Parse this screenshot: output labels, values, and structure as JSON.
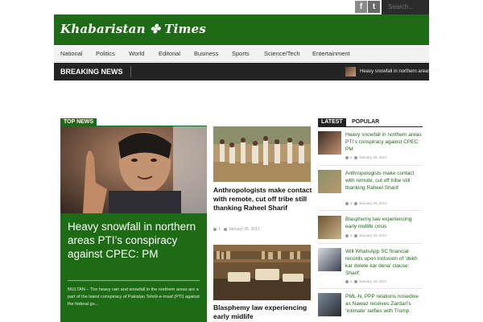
{
  "topbar": {
    "social": [
      {
        "name": "facebook-icon",
        "glyph": "f"
      },
      {
        "name": "twitter-icon",
        "glyph": "t"
      }
    ],
    "search_placeholder": "Search..."
  },
  "masthead": {
    "logo_text": "Khabaristan ✤ Times"
  },
  "nav": {
    "items": [
      "National",
      "Politics",
      "World",
      "Editorial",
      "Business",
      "Sports",
      "Science/Tech",
      "Entertainment"
    ]
  },
  "breaking": {
    "label": "BREAKING NEWS",
    "ticker": "Heavy snowfall in northern areas PTI"
  },
  "top_news": {
    "tag": "TOP NEWS",
    "title": "Heavy snowfall in northern areas PTI’s conspiracy against CPEC: PM",
    "excerpt": "MULTAN – The heavy rain and snowfall in the northern areas are a part of the latest conspiracy of Pakistan Tehrik-e-Insaf (PTI) against the federal go..."
  },
  "middle": [
    {
      "title": "Anthropologists make contact with remote, cut off tribe still thanking Raheel Sharif",
      "comments": "1",
      "date": "January 25, 2017"
    },
    {
      "title": "Blasphemy law experiencing early midlife"
    }
  ],
  "sidebar": {
    "tabs": [
      "LATEST",
      "POPULAR"
    ],
    "items": [
      {
        "title": "Heavy snowfall in northern areas PTI’s conspiracy against CPEC: PM",
        "comments": "0",
        "date": "January 25, 2017"
      },
      {
        "title": "Anthropologists make contact with remote, cut off tribe still thanking Raheel Sharif",
        "comments": "0",
        "date": "January 25, 2017"
      },
      {
        "title": "Blasphemy law experiencing early midlife crisis",
        "comments": "0",
        "date": "January 24, 2017"
      },
      {
        "title": "Will WhatsApp SC financial records upon inclusion of ‘dekh kar delete kar dena’ clause: Sharif",
        "comments": "0",
        "date": "January 24, 2017"
      },
      {
        "title": "PML-N, PPP relations nosedive as Nawaz receives Zardari’s ‘intimate’ selfies with Trump"
      }
    ]
  },
  "colors": {
    "brand_green": "#1e6b15",
    "dark_bar": "#242424",
    "nav_bg": "#f2f2f2"
  }
}
